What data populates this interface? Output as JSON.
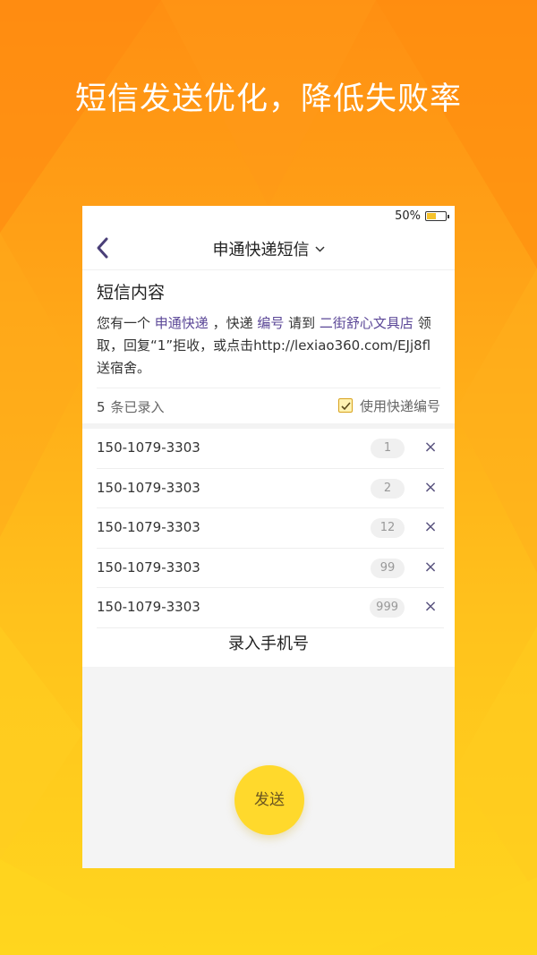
{
  "colors": {
    "accent": "#ffd92c",
    "highlight": "#5b4797",
    "bg_top": "#ff8f12",
    "bg_bottom": "#ffd61e"
  },
  "headline": "短信发送优化，降低失败率",
  "status": {
    "battery_text": "50%",
    "battery_level": 0.5
  },
  "nav": {
    "back_icon": "chevron-left-icon",
    "title": "申通快递短信",
    "dropdown_icon": "chevron-down-icon"
  },
  "sms": {
    "label": "短信内容",
    "parts": {
      "p1": "您有一个 ",
      "company": "申通快递",
      "p2": " ，快递 ",
      "number_tag": "编号",
      "p3": " 请到 ",
      "store": "二街舒心文具店",
      "p4": " 领取，回复“1”拒收，或点击http://lexiao360.com/EJj8fl送宿舍。"
    }
  },
  "count": {
    "number": "5",
    "label": "条已录入"
  },
  "toggle": {
    "label": "使用快递编号",
    "checked": true
  },
  "rows": [
    {
      "phone": "150-1079-3303",
      "tag": "1"
    },
    {
      "phone": "150-1079-3303",
      "tag": "2"
    },
    {
      "phone": "150-1079-3303",
      "tag": "12"
    },
    {
      "phone": "150-1079-3303",
      "tag": "99"
    },
    {
      "phone": "150-1079-3303",
      "tag": "999"
    }
  ],
  "delete_symbol": "×",
  "add_phone_label": "录入手机号",
  "send_label": "发送"
}
